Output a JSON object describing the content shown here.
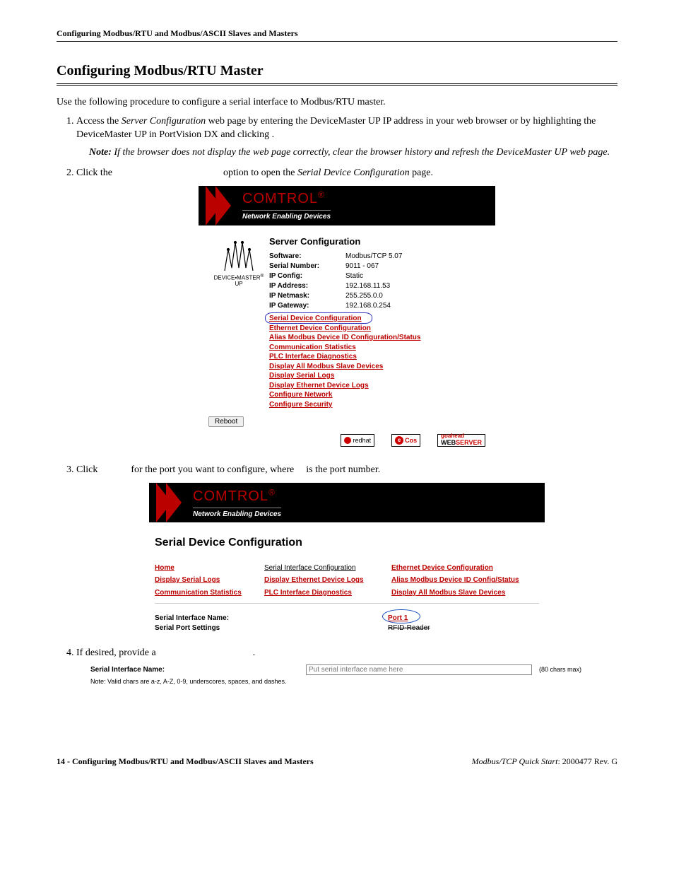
{
  "runningHeader": "Configuring Modbus/RTU and Modbus/ASCII Slaves and Masters",
  "sectionTitle": "Configuring Modbus/RTU Master",
  "intro": "Use the following procedure to configure a serial interface to Modbus/RTU master.",
  "steps": {
    "s1a": "Access the ",
    "s1i": "Server Configuration",
    "s1b": " web page by entering the DeviceMaster UP IP address in your web browser or by highlighting the DeviceMaster UP in PortVision DX and clicking ",
    "s1c": ".",
    "noteLabel": "Note:",
    "noteText": "If the browser does not display the web page correctly, clear the browser history and refresh the DeviceMaster UP web page.",
    "s2a": "Click the ",
    "s2b": " option to open the ",
    "s2i": "Serial Device Configuration",
    "s2c": " page.",
    "s3a": "Click ",
    "s3b": " for the port you want to configure, where ",
    "s3c": " is the port number.",
    "s4a": "If desired, provide a ",
    "s4b": "."
  },
  "comtrol": {
    "brand": "COMTROL",
    "tag": "Network Enabling Devices"
  },
  "serverConfig": {
    "logoLine1": "DEVICE•MASTER",
    "logoReg": "®",
    "logoLine2": "UP",
    "heading": "Server Configuration",
    "rows": [
      {
        "k": "Software:",
        "v": "Modbus/TCP 5.07"
      },
      {
        "k": "Serial Number:",
        "v": "9011 - 067"
      },
      {
        "k": "IP Config:",
        "v": "Static"
      },
      {
        "k": "IP Address:",
        "v": "192.168.11.53"
      },
      {
        "k": "IP Netmask:",
        "v": "255.255.0.0"
      },
      {
        "k": "IP Gateway:",
        "v": "192.168.0.254"
      }
    ],
    "links": [
      "Serial Device Configuration",
      "Ethernet Device Configuration",
      "Alias Modbus Device ID Configuration/Status",
      "Communication Statistics",
      "PLC Interface Diagnostics",
      "Display All Modbus Slave Devices",
      "Display Serial Logs",
      "Display Ethernet Device Logs",
      "Configure Network",
      "Configure Security"
    ],
    "rebootLabel": "Reboot",
    "badges": {
      "redhat": "redhat",
      "ecos": "eCos",
      "ws1": "goahead",
      "ws2a": "WEB",
      "ws2b": "SERVER"
    }
  },
  "serialDeviceConfig": {
    "heading": "Serial Device Configuration",
    "grid": [
      [
        "Home",
        "Serial Interface Configuration",
        "Ethernet Device Configuration"
      ],
      [
        "Display Serial Logs",
        "Display Ethernet Device Logs",
        "Alias Modbus Device ID Config/Status"
      ],
      [
        "Communication Statistics",
        "PLC Interface Diagnostics",
        "Display All Modbus Slave Devices"
      ]
    ],
    "labels": {
      "sin": "Serial Interface Name:",
      "sps": "Serial Port Settings"
    },
    "values": {
      "portLink": "Port 1",
      "rfid": "RFID-Reader"
    }
  },
  "step4Form": {
    "label": "Serial Interface Name:",
    "placeholder": "Put serial interface name here",
    "max": "(80 chars max)",
    "note": "Note: Valid chars are a-z, A-Z, 0-9, underscores, spaces, and dashes."
  },
  "footer": {
    "leftNum": "14 - ",
    "leftText": "Configuring Modbus/RTU and Modbus/ASCII Slaves and Masters",
    "rightItalic": "Modbus/TCP Quick Start",
    "rightRest": ": 2000477 Rev. G"
  }
}
